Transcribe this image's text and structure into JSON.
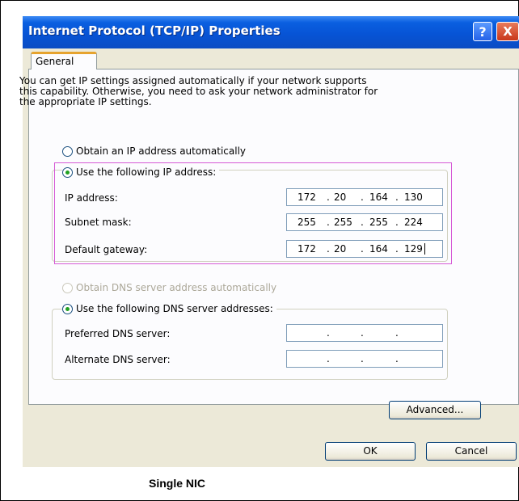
{
  "window": {
    "title": "Internet Protocol (TCP/IP) Properties",
    "help_label": "?",
    "close_label": "X"
  },
  "tabs": [
    {
      "label": "General",
      "selected": true
    }
  ],
  "description": [
    "You can get IP settings assigned automatically if your network supports",
    "this capability. Otherwise, you need to ask your network administrator for",
    "the appropriate IP settings."
  ],
  "ip_options": {
    "auto": {
      "label": "Obtain an IP address automatically",
      "checked": false
    },
    "manual": {
      "label": "Use the following IP address:",
      "checked": true
    }
  },
  "ip_fields": {
    "ip_address": {
      "label": "IP address:",
      "octets": [
        "172",
        "20",
        "164",
        "130"
      ]
    },
    "subnet_mask": {
      "label": "Subnet mask:",
      "octets": [
        "255",
        "255",
        "255",
        "224"
      ]
    },
    "default_gateway": {
      "label": "Default gateway:",
      "octets": [
        "172",
        "20",
        "164",
        "129"
      ]
    }
  },
  "dns_options": {
    "auto": {
      "label": "Obtain DNS server address automatically",
      "checked": false,
      "disabled": true
    },
    "manual": {
      "label": "Use the following DNS server addresses:",
      "checked": true
    }
  },
  "dns_fields": {
    "preferred": {
      "label": "Preferred DNS server:",
      "octets": [
        "",
        "",
        "",
        ""
      ]
    },
    "alternate": {
      "label": "Alternate DNS server:",
      "octets": [
        "",
        "",
        "",
        ""
      ]
    }
  },
  "buttons": {
    "advanced": "Advanced...",
    "ok": "OK",
    "cancel": "Cancel"
  },
  "caption": "Single NIC",
  "colors": {
    "title_bar": "#0754d6",
    "dialog_bg": "#ece9d8",
    "highlight_border": "#d65ad6",
    "radio_dot": "#21a121"
  }
}
